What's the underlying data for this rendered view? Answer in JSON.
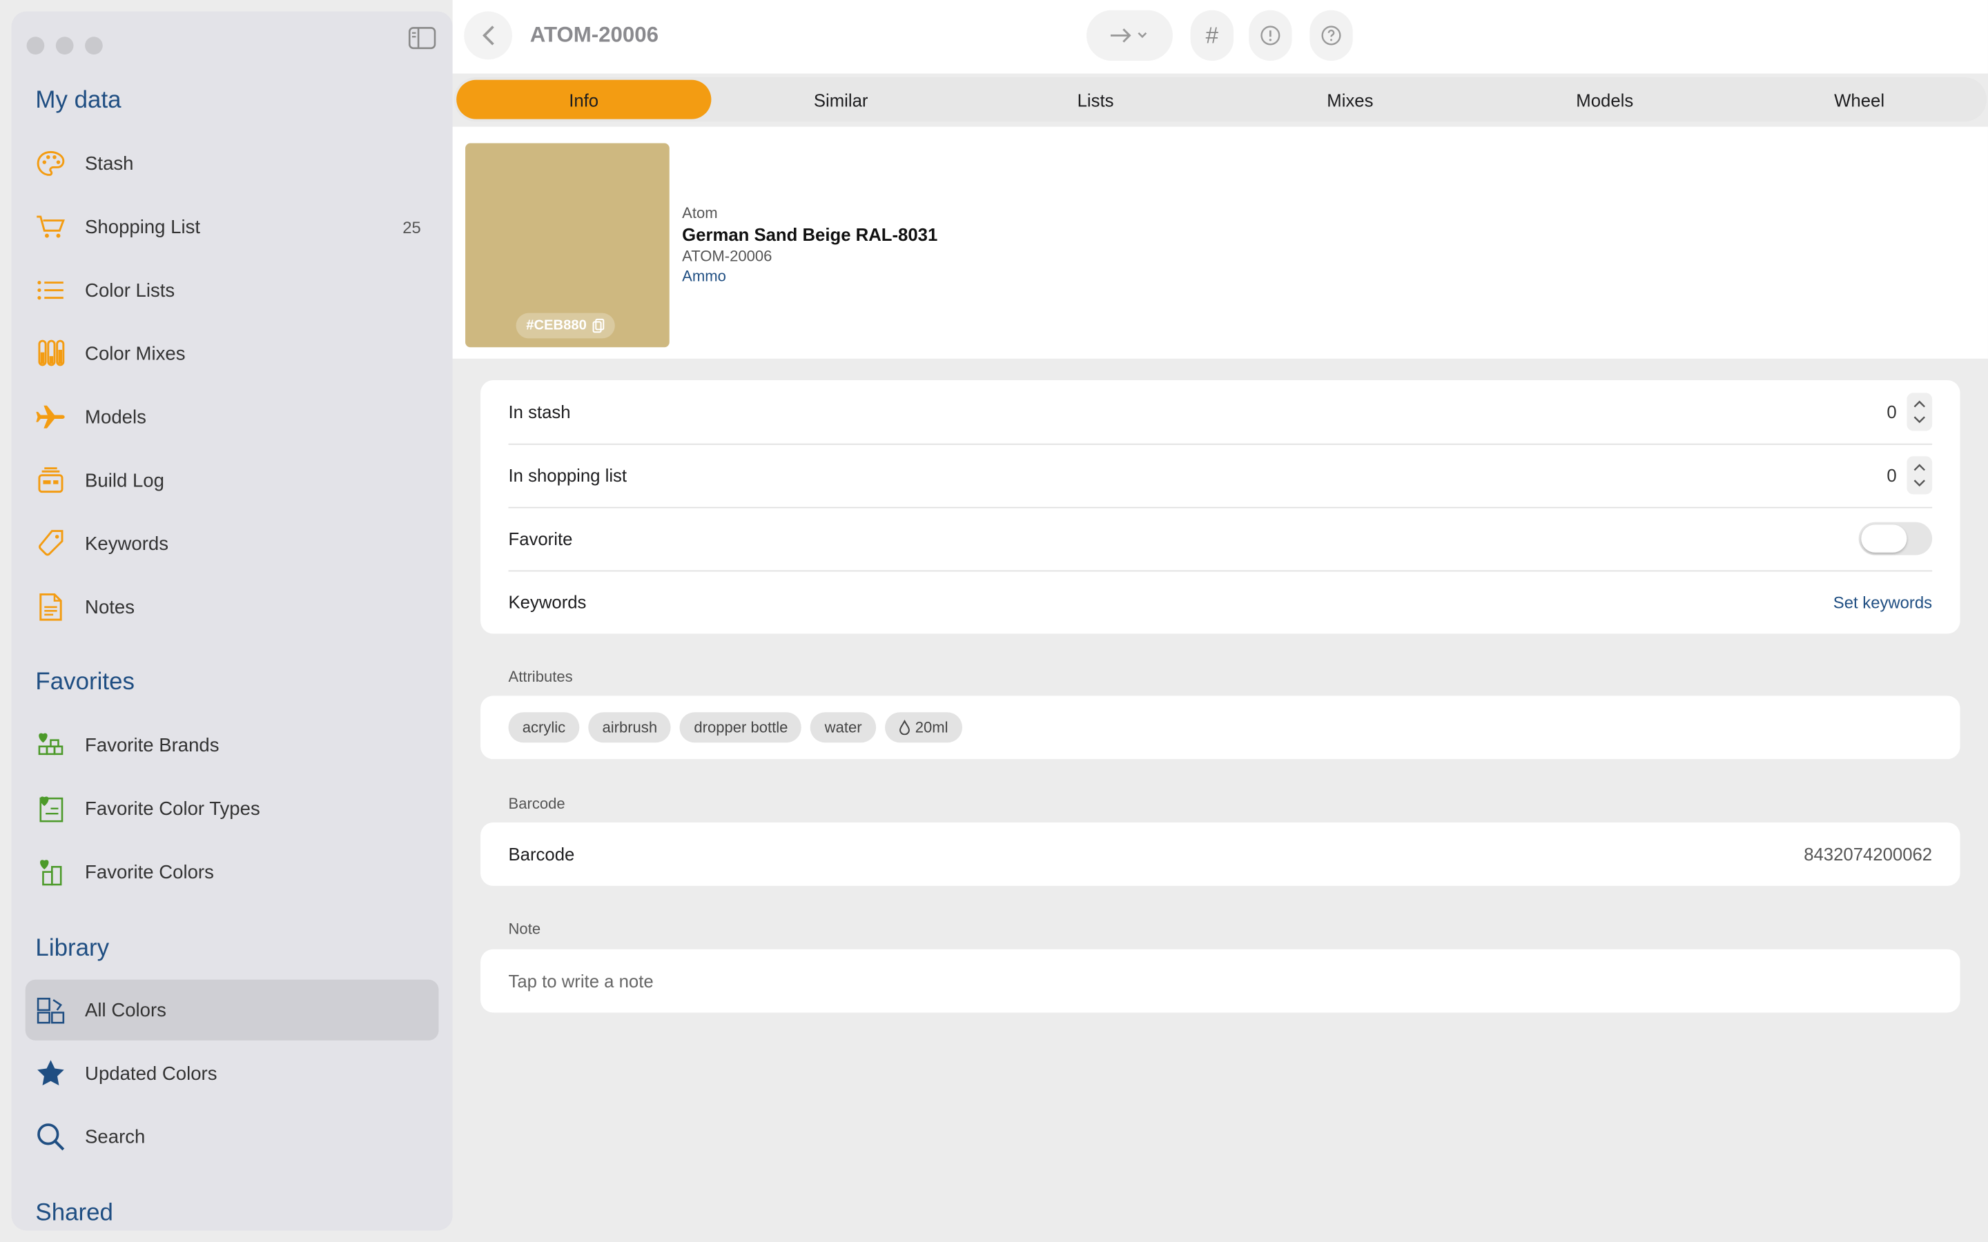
{
  "sidebar": {
    "sections": {
      "my_data": "My data",
      "favorites": "Favorites",
      "library": "Library",
      "shared": "Shared"
    },
    "items": [
      {
        "label": "Stash",
        "icon": "palette-icon"
      },
      {
        "label": "Shopping List",
        "icon": "cart-icon",
        "count": "25"
      },
      {
        "label": "Color Lists",
        "icon": "list-icon"
      },
      {
        "label": "Color Mixes",
        "icon": "test-tubes-icon"
      },
      {
        "label": "Models",
        "icon": "airplane-icon"
      },
      {
        "label": "Build Log",
        "icon": "build-log-icon"
      },
      {
        "label": "Keywords",
        "icon": "tag-icon"
      },
      {
        "label": "Notes",
        "icon": "document-icon"
      },
      {
        "label": "Favorite Brands",
        "icon": "favorite-brands-icon"
      },
      {
        "label": "Favorite Color Types",
        "icon": "favorite-color-types-icon"
      },
      {
        "label": "Favorite Colors",
        "icon": "favorite-colors-icon"
      },
      {
        "label": "All Colors",
        "icon": "all-colors-icon",
        "selected": true
      },
      {
        "label": "Updated Colors",
        "icon": "star-icon"
      },
      {
        "label": "Search",
        "icon": "search-icon"
      }
    ]
  },
  "toolbar": {
    "title": "ATOM-20006",
    "hash_label": "#"
  },
  "tabs": [
    "Info",
    "Similar",
    "Lists",
    "Mixes",
    "Models",
    "Wheel"
  ],
  "color": {
    "hex": "#CEB880",
    "brand": "Atom",
    "name": "German Sand Beige RAL-8031",
    "code": "ATOM-20006",
    "maker": "Ammo"
  },
  "details": {
    "in_stash_label": "In stash",
    "in_stash_value": "0",
    "in_shopping_label": "In shopping list",
    "in_shopping_value": "0",
    "favorite_label": "Favorite",
    "keywords_label": "Keywords",
    "keywords_action": "Set keywords"
  },
  "attributes": {
    "label": "Attributes",
    "chips": [
      "acrylic",
      "airbrush",
      "dropper bottle",
      "water",
      "20ml"
    ]
  },
  "barcode": {
    "group_label": "Barcode",
    "row_label": "Barcode",
    "value": "8432074200062"
  },
  "note": {
    "group_label": "Note",
    "placeholder": "Tap to write a note"
  },
  "colors": {
    "accent": "#F39C12",
    "link": "#1F4E82",
    "favorite_green": "#4C9A2A"
  }
}
